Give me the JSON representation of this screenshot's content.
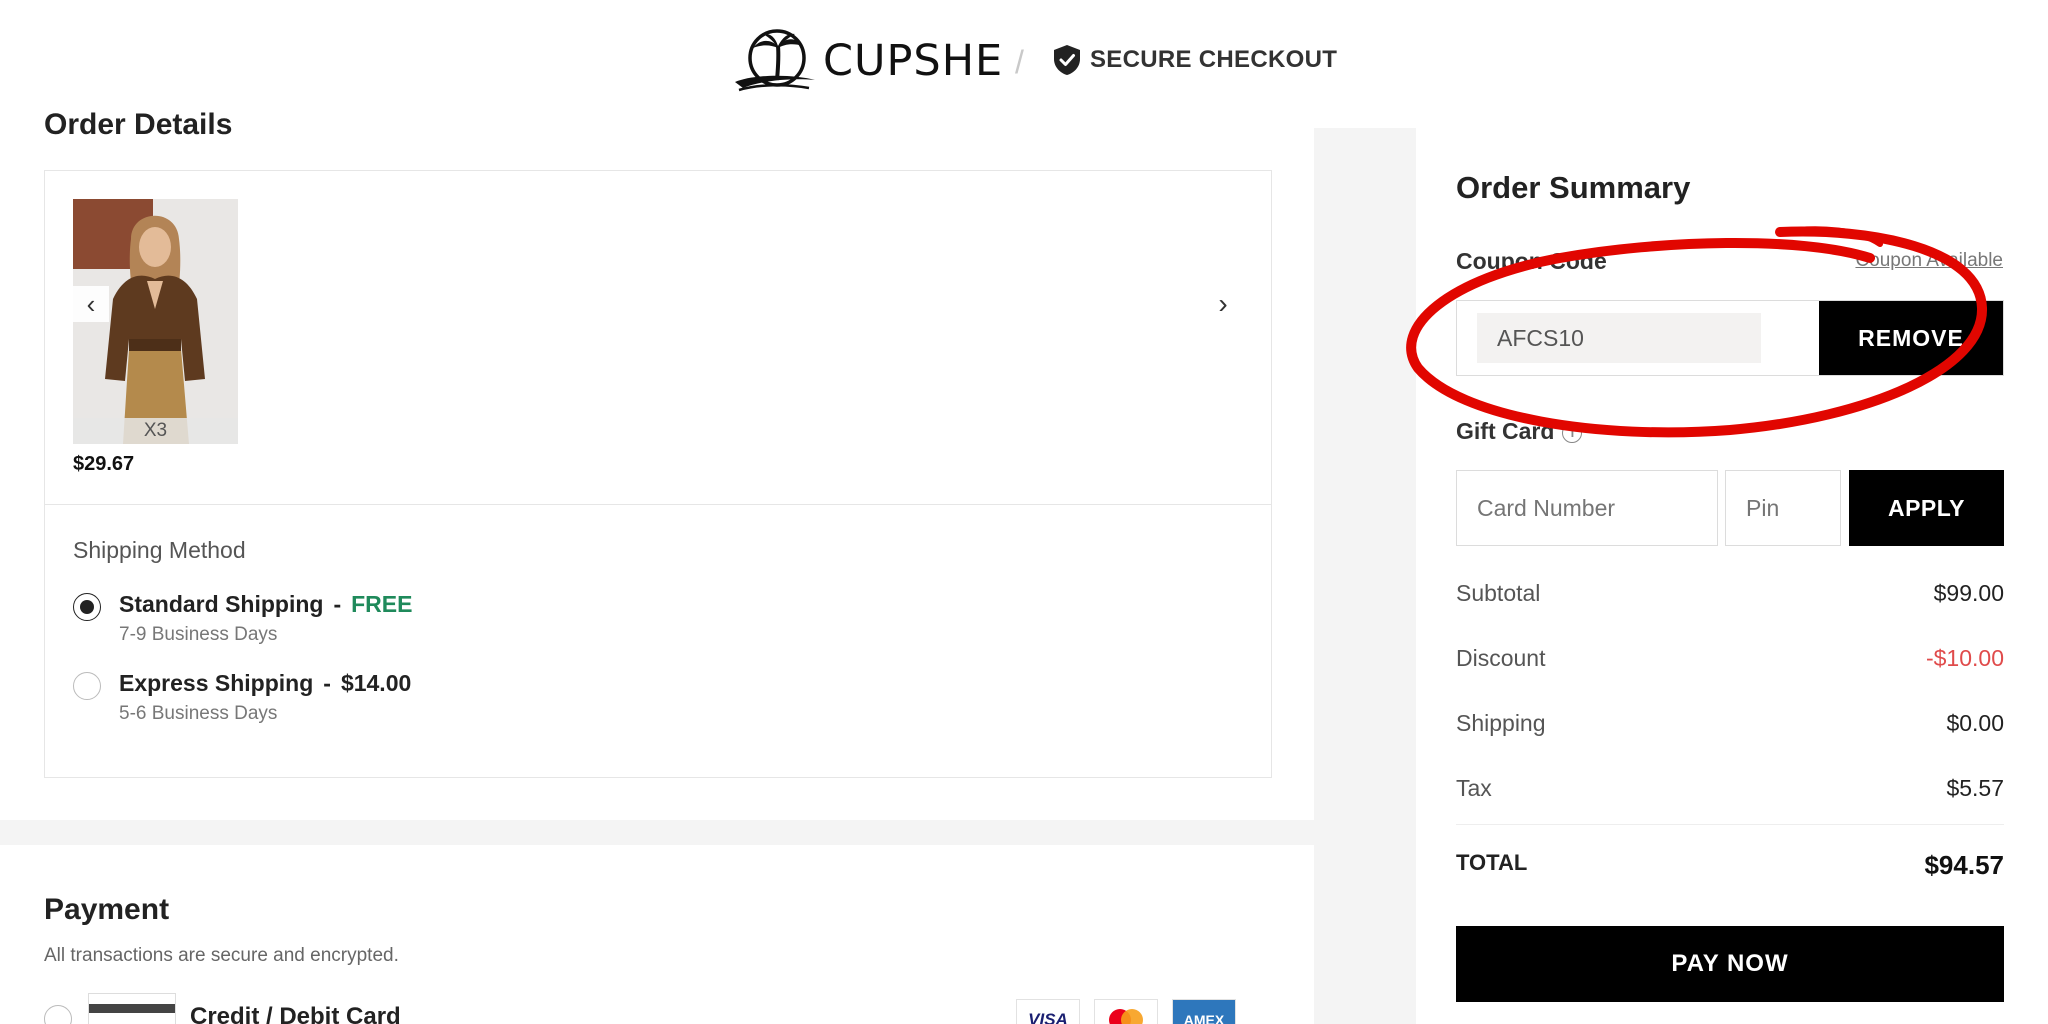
{
  "header": {
    "brand_name": "CUPSHE",
    "separator": "/",
    "secure_label": "SECURE CHECKOUT"
  },
  "order": {
    "title": "Order Details",
    "item": {
      "quantity_label": "X3",
      "price": "$29.67"
    },
    "shipping": {
      "title": "Shipping Method",
      "options": [
        {
          "name": "Standard Shipping",
          "dash": "-",
          "price": "FREE",
          "days": "7-9 Business Days",
          "selected": true
        },
        {
          "name": "Express Shipping",
          "dash": "-",
          "price": "$14.00",
          "days": "5-6 Business Days",
          "selected": false
        }
      ]
    }
  },
  "payment": {
    "title": "Payment",
    "subtitle": "All transactions are secure and encrypted.",
    "method_label": "Credit / Debit Card",
    "card_brands": [
      "VISA",
      "",
      "AMEX"
    ]
  },
  "summary": {
    "title": "Order Summary",
    "coupon_label": "Coupon Code",
    "coupon_link": "Coupon Available",
    "coupon_value": "AFCS10",
    "remove_label": "REMOVE",
    "gift_label": "Gift Card",
    "card_number_placeholder": "Card Number",
    "pin_placeholder": "Pin",
    "apply_label": "APPLY",
    "rows": [
      {
        "label": "Subtotal",
        "value": "$99.00"
      },
      {
        "label": "Discount",
        "value": "-$10.00"
      },
      {
        "label": "Shipping",
        "value": "$0.00"
      },
      {
        "label": "Tax",
        "value": "$5.57"
      }
    ],
    "total_label": "TOTAL",
    "total_value": "$94.57",
    "pay_label": "PAY NOW"
  },
  "colors": {
    "accent_free": "#1f8a5b",
    "discount": "#e04b4b",
    "annotation": "#e10600",
    "button": "#000000"
  }
}
